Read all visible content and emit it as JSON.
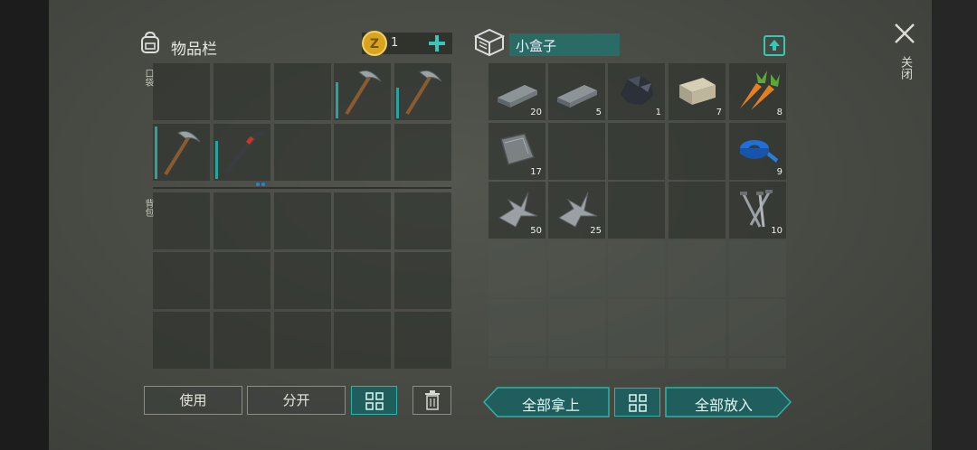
{
  "inventory": {
    "title": "物品栏",
    "coins": "1",
    "pocket_label": "口袋",
    "backpack_label": "背包"
  },
  "container": {
    "name": "小盒子",
    "items": [
      {
        "name": "iron-bar",
        "qty": "20"
      },
      {
        "name": "iron-bar",
        "qty": "5"
      },
      {
        "name": "coal-ore",
        "qty": "1"
      },
      {
        "name": "stone-block",
        "qty": "7"
      },
      {
        "name": "carrot",
        "qty": "8"
      },
      {
        "name": "metal-plate",
        "qty": "17"
      },
      {
        "name": "blue-tape",
        "qty": "9"
      },
      {
        "name": "metal-scrap",
        "qty": "50"
      },
      {
        "name": "metal-scrap",
        "qty": "25"
      },
      {
        "name": "nails",
        "qty": "10"
      }
    ]
  },
  "buttons": {
    "use": "使用",
    "split": "分开",
    "take_all": "全部拿上",
    "put_all": "全部放入"
  },
  "close": {
    "label": "关闭"
  },
  "colors": {
    "accent": "#2fb3a9",
    "durability": "#2aa3a0"
  }
}
